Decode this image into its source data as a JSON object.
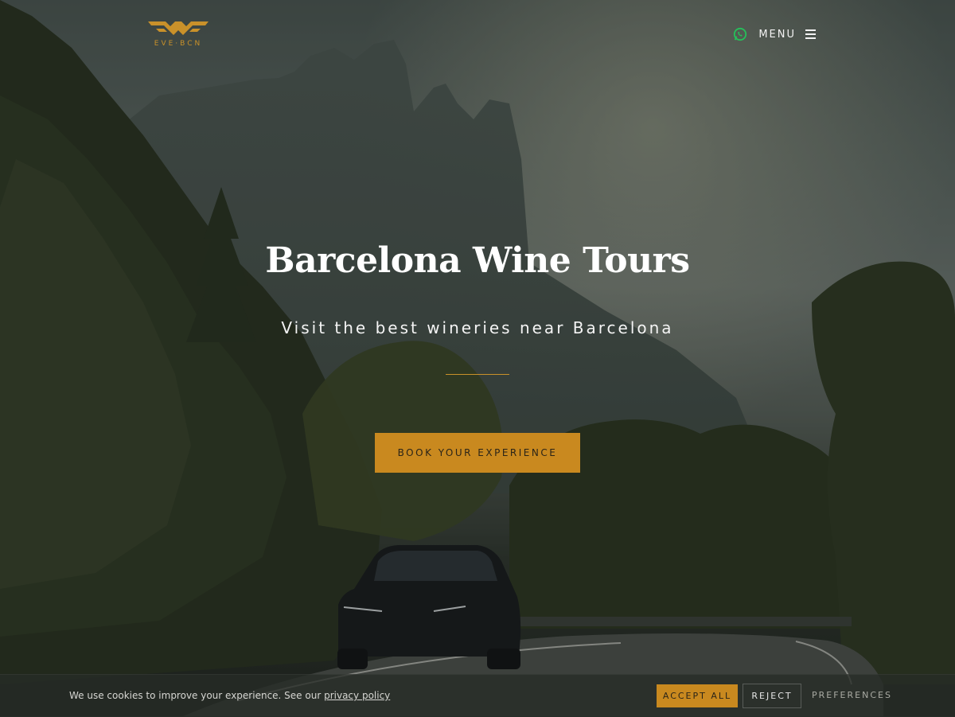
{
  "brand": {
    "logo_text": "EVE·BCN",
    "accent_color": "#c9891f"
  },
  "nav": {
    "whatsapp_icon": "whatsapp-icon",
    "menu_label": "MENU",
    "menu_icon": "hamburger-icon"
  },
  "hero": {
    "title": "Barcelona Wine Tours",
    "subtitle": "Visit the best wineries near Barcelona",
    "cta_label": "BOOK YOUR EXPERIENCE",
    "background": "mountain road with car photo"
  },
  "cookie_banner": {
    "text": "We use cookies to improve your experience. See our",
    "link_text": "privacy policy",
    "accept_label": "ACCEPT ALL",
    "reject_label": "REJECT",
    "preferences_label": "PREFERENCES"
  }
}
